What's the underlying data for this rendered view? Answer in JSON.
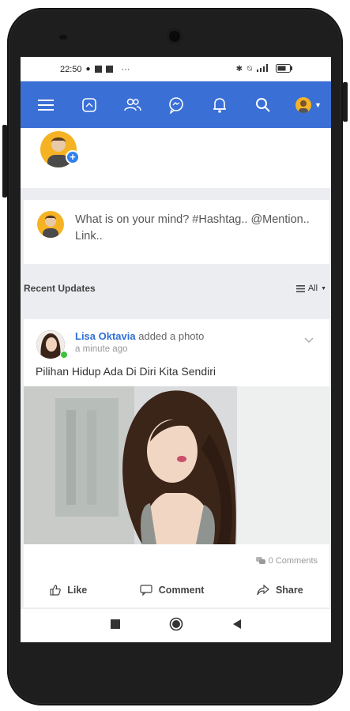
{
  "status_bar": {
    "time": "22:50",
    "dots": "···",
    "right_icons": [
      "bluetooth-icon",
      "mute-icon",
      "signal-icon",
      "battery-icon"
    ]
  },
  "top_nav": {
    "icons": [
      "menu-icon",
      "home-icon",
      "friends-icon",
      "messages-icon",
      "notifications-icon",
      "search-icon",
      "profile-avatar"
    ],
    "background": "#3a6fd6"
  },
  "compose": {
    "placeholder": "What is on your mind? #Hashtag.. @Mention.. Link.."
  },
  "recent": {
    "title": "Recent Updates",
    "filter_label": "All"
  },
  "post": {
    "author": "Lisa Oktavia",
    "action_text": "added a photo",
    "time": "a minute ago",
    "text": "Pilihan Hidup Ada Di Diri Kita Sendiri",
    "comments": "0 Comments",
    "like_label": "Like",
    "comment_label": "Comment",
    "share_label": "Share"
  },
  "colors": {
    "accent": "#3a6fd6",
    "author": "#2f6fd6",
    "online": "#3ec13e"
  }
}
